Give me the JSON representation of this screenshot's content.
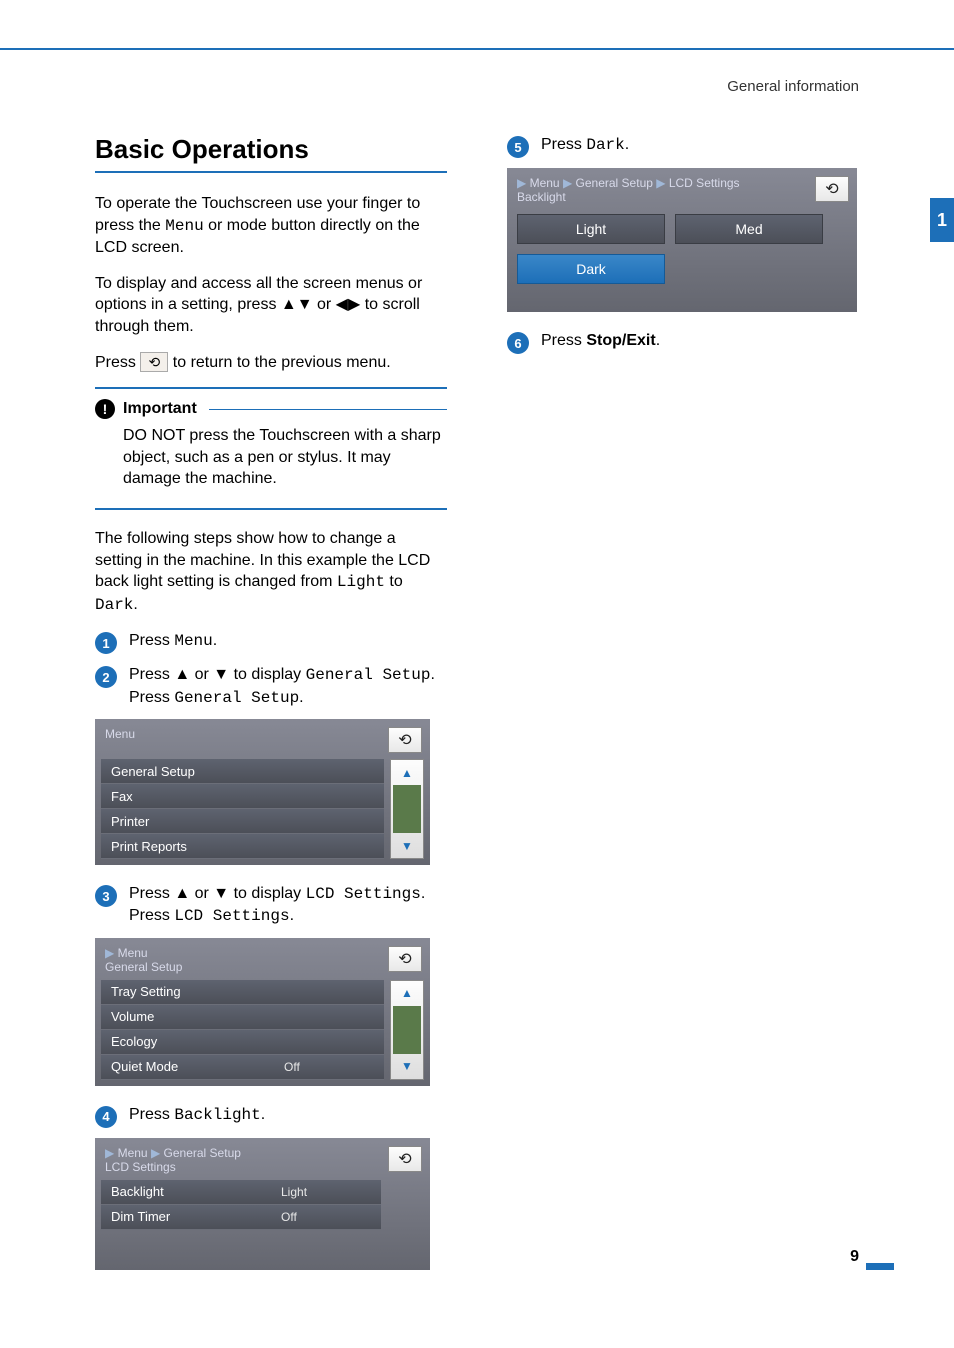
{
  "header_right": "General information",
  "side_tab": "1",
  "page_number": "9",
  "title": "Basic Operations",
  "para1_a": "To operate the Touchscreen use your finger to press the ",
  "para1_mono": "Menu",
  "para1_b": " or mode button directly on the LCD screen.",
  "para2": "To display and access all the screen menus or options in a setting, press ▲▼ or ◀▶ to scroll through them.",
  "para3_a": "Press ",
  "para3_b": " to return to the previous menu.",
  "back_glyph": "↻",
  "important": {
    "label": "Important",
    "text": "DO NOT press the Touchscreen with a sharp object, such as a pen or stylus. It may damage the machine."
  },
  "para4_a": "The following steps show how to change a setting in the machine. In this example the LCD back light setting is changed from ",
  "para4_m1": "Light",
  "para4_mid": " to ",
  "para4_m2": "Dark",
  "para4_end": ".",
  "steps": {
    "s1": {
      "num": "1",
      "a": "Press ",
      "mono": "Menu",
      "b": "."
    },
    "s2": {
      "num": "2",
      "a": "Press ▲ or ▼ to display ",
      "mono1": "General Setup",
      "b": ".",
      "c": "Press ",
      "mono2": "General Setup",
      "d": "."
    },
    "s3": {
      "num": "3",
      "a": "Press ▲ or ▼ to display ",
      "mono1": "LCD Settings",
      "b": ".",
      "c": "Press ",
      "mono2": "LCD Settings",
      "d": "."
    },
    "s4": {
      "num": "4",
      "a": "Press ",
      "mono": "Backlight",
      "b": "."
    },
    "s5": {
      "num": "5",
      "a": "Press ",
      "mono": "Dark",
      "b": "."
    },
    "s6": {
      "num": "6",
      "a": "Press ",
      "bold": "Stop/Exit",
      "b": "."
    }
  },
  "lcd1": {
    "title": "Menu",
    "rows": [
      "General Setup",
      "Fax",
      "Printer",
      "Print Reports"
    ]
  },
  "lcd2": {
    "bc0": "Menu",
    "sub": "General  Setup",
    "rows": [
      {
        "label": "Tray Setting",
        "val": ""
      },
      {
        "label": "Volume",
        "val": ""
      },
      {
        "label": "Ecology",
        "val": ""
      },
      {
        "label": "Quiet Mode",
        "val": "Off"
      }
    ]
  },
  "lcd3": {
    "bc0": "Menu",
    "bc1": "General Setup",
    "sub": "LCD Settings",
    "rows": [
      {
        "label": "Backlight",
        "val": "Light"
      },
      {
        "label": "Dim Timer",
        "val": "Off"
      }
    ]
  },
  "lcd4": {
    "bc0": "Menu",
    "bc1": "General Setup",
    "bc2": "LCD Settings",
    "sub": "Backlight",
    "opts": [
      "Light",
      "Med",
      "Dark"
    ]
  },
  "arrow_up": "▲",
  "arrow_down": "▼",
  "caret": "▶"
}
